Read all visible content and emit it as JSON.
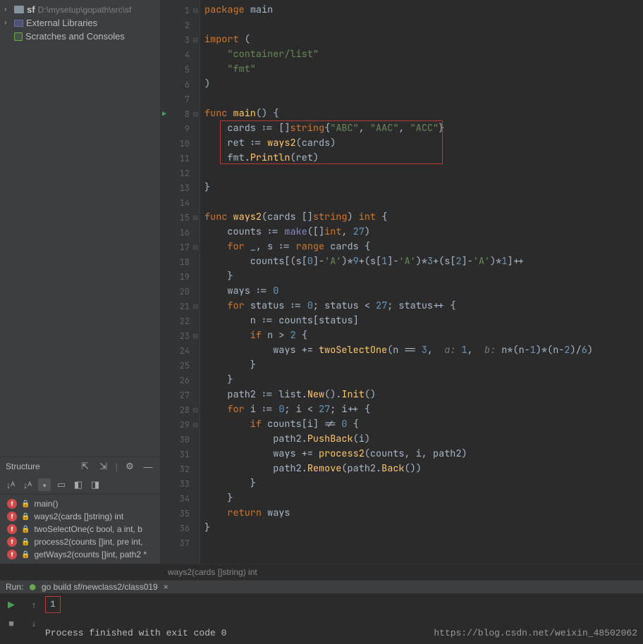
{
  "project": {
    "root_name": "sf",
    "root_path": "D:\\mysetup\\gopath\\src\\sf",
    "external_libs": "External Libraries",
    "scratches": "Scratches and Consoles"
  },
  "structure": {
    "title": "Structure",
    "items": [
      "main()",
      "ways2(cards []string) int",
      "twoSelectOne(c bool, a int, b",
      "process2(counts []int, pre int,",
      "getWays2(counts []int, path2 *"
    ]
  },
  "gutter": {
    "start": 1,
    "end": 37,
    "run_line": 8,
    "fold_minus": [
      1,
      3,
      8,
      15,
      17,
      21,
      23,
      28,
      29
    ],
    "fold_plus": []
  },
  "code": {
    "lines": [
      {
        "tokens": [
          {
            "t": "package ",
            "c": "kw"
          },
          {
            "t": "main",
            "c": "ident"
          }
        ]
      },
      {
        "tokens": []
      },
      {
        "tokens": [
          {
            "t": "import ",
            "c": "kw"
          },
          {
            "t": "(",
            "c": "ident"
          }
        ]
      },
      {
        "tokens": [
          {
            "t": "    \"container/list\"",
            "c": "str"
          }
        ]
      },
      {
        "tokens": [
          {
            "t": "    \"fmt\"",
            "c": "str"
          }
        ]
      },
      {
        "tokens": [
          {
            "t": ")",
            "c": "ident"
          }
        ]
      },
      {
        "tokens": []
      },
      {
        "tokens": [
          {
            "t": "func ",
            "c": "kw"
          },
          {
            "t": "main",
            "c": "fn"
          },
          {
            "t": "() {",
            "c": "ident"
          }
        ]
      },
      {
        "tokens": [
          {
            "t": "    cards := []",
            "c": "ident"
          },
          {
            "t": "string",
            "c": "kw"
          },
          {
            "t": "{",
            "c": "ident"
          },
          {
            "t": "\"ABC\"",
            "c": "str"
          },
          {
            "t": ", ",
            "c": "ident"
          },
          {
            "t": "\"AAC\"",
            "c": "str"
          },
          {
            "t": ", ",
            "c": "ident"
          },
          {
            "t": "\"ACC\"",
            "c": "str"
          },
          {
            "t": "}",
            "c": "ident"
          }
        ]
      },
      {
        "tokens": [
          {
            "t": "    ret := ",
            "c": "ident"
          },
          {
            "t": "ways2",
            "c": "fn"
          },
          {
            "t": "(cards)",
            "c": "ident"
          }
        ]
      },
      {
        "tokens": [
          {
            "t": "    fmt.",
            "c": "ident"
          },
          {
            "t": "Println",
            "c": "fn"
          },
          {
            "t": "(ret)",
            "c": "ident"
          }
        ]
      },
      {
        "tokens": []
      },
      {
        "tokens": [
          {
            "t": "}",
            "c": "ident"
          }
        ]
      },
      {
        "tokens": []
      },
      {
        "tokens": [
          {
            "t": "func ",
            "c": "kw"
          },
          {
            "t": "ways2",
            "c": "fn"
          },
          {
            "t": "(cards []",
            "c": "ident"
          },
          {
            "t": "string",
            "c": "kw"
          },
          {
            "t": ") ",
            "c": "ident"
          },
          {
            "t": "int",
            "c": "kw"
          },
          {
            "t": " {",
            "c": "ident"
          }
        ]
      },
      {
        "tokens": [
          {
            "t": "    counts := ",
            "c": "ident"
          },
          {
            "t": "make",
            "c": "builtin"
          },
          {
            "t": "([]",
            "c": "ident"
          },
          {
            "t": "int",
            "c": "kw"
          },
          {
            "t": ", ",
            "c": "ident"
          },
          {
            "t": "27",
            "c": "num"
          },
          {
            "t": ")",
            "c": "ident"
          }
        ]
      },
      {
        "tokens": [
          {
            "t": "    for ",
            "c": "kw"
          },
          {
            "t": "_, s := ",
            "c": "ident"
          },
          {
            "t": "range ",
            "c": "kw"
          },
          {
            "t": "cards {",
            "c": "ident"
          }
        ]
      },
      {
        "tokens": [
          {
            "t": "        counts[(s[",
            "c": "ident"
          },
          {
            "t": "0",
            "c": "num"
          },
          {
            "t": "]-",
            "c": "ident"
          },
          {
            "t": "'A'",
            "c": "str"
          },
          {
            "t": ")*",
            "c": "ident"
          },
          {
            "t": "9",
            "c": "num"
          },
          {
            "t": "+(s[",
            "c": "ident"
          },
          {
            "t": "1",
            "c": "num"
          },
          {
            "t": "]-",
            "c": "ident"
          },
          {
            "t": "'A'",
            "c": "str"
          },
          {
            "t": ")*",
            "c": "ident"
          },
          {
            "t": "3",
            "c": "num"
          },
          {
            "t": "+(s[",
            "c": "ident"
          },
          {
            "t": "2",
            "c": "num"
          },
          {
            "t": "]-",
            "c": "ident"
          },
          {
            "t": "'A'",
            "c": "str"
          },
          {
            "t": ")*",
            "c": "ident"
          },
          {
            "t": "1",
            "c": "num"
          },
          {
            "t": "]++",
            "c": "ident"
          }
        ]
      },
      {
        "tokens": [
          {
            "t": "    }",
            "c": "ident"
          }
        ]
      },
      {
        "tokens": [
          {
            "t": "    ways := ",
            "c": "ident"
          },
          {
            "t": "0",
            "c": "num"
          }
        ]
      },
      {
        "tokens": [
          {
            "t": "    for ",
            "c": "kw"
          },
          {
            "t": "status := ",
            "c": "ident"
          },
          {
            "t": "0",
            "c": "num"
          },
          {
            "t": "; status < ",
            "c": "ident"
          },
          {
            "t": "27",
            "c": "num"
          },
          {
            "t": "; status++ {",
            "c": "ident"
          }
        ]
      },
      {
        "tokens": [
          {
            "t": "        n := counts[status]",
            "c": "ident"
          }
        ]
      },
      {
        "tokens": [
          {
            "t": "        if ",
            "c": "kw"
          },
          {
            "t": "n > ",
            "c": "ident"
          },
          {
            "t": "2",
            "c": "num"
          },
          {
            "t": " {",
            "c": "ident"
          }
        ]
      },
      {
        "tokens": [
          {
            "t": "            ways += ",
            "c": "ident"
          },
          {
            "t": "twoSelectOne",
            "c": "fn"
          },
          {
            "t": "(n == ",
            "c": "ident"
          },
          {
            "t": "3",
            "c": "num"
          },
          {
            "t": ",  ",
            "c": "ident"
          },
          {
            "t": "a: ",
            "c": "comment-hint"
          },
          {
            "t": "1",
            "c": "num"
          },
          {
            "t": ",  ",
            "c": "ident"
          },
          {
            "t": "b: ",
            "c": "comment-hint"
          },
          {
            "t": "n*(n-",
            "c": "ident"
          },
          {
            "t": "1",
            "c": "num"
          },
          {
            "t": ")*(n-",
            "c": "ident"
          },
          {
            "t": "2",
            "c": "num"
          },
          {
            "t": ")/",
            "c": "ident"
          },
          {
            "t": "6",
            "c": "num"
          },
          {
            "t": ")",
            "c": "ident"
          }
        ]
      },
      {
        "tokens": [
          {
            "t": "        }",
            "c": "ident"
          }
        ]
      },
      {
        "tokens": [
          {
            "t": "    }",
            "c": "ident"
          }
        ]
      },
      {
        "tokens": [
          {
            "t": "    path2 := list.",
            "c": "ident"
          },
          {
            "t": "New",
            "c": "fn"
          },
          {
            "t": "().",
            "c": "ident"
          },
          {
            "t": "Init",
            "c": "fn"
          },
          {
            "t": "()",
            "c": "ident"
          }
        ]
      },
      {
        "tokens": [
          {
            "t": "    for ",
            "c": "kw"
          },
          {
            "t": "i := ",
            "c": "ident"
          },
          {
            "t": "0",
            "c": "num"
          },
          {
            "t": "; i < ",
            "c": "ident"
          },
          {
            "t": "27",
            "c": "num"
          },
          {
            "t": "; i++ {",
            "c": "ident"
          }
        ]
      },
      {
        "tokens": [
          {
            "t": "        if ",
            "c": "kw"
          },
          {
            "t": "counts[i] != ",
            "c": "ident"
          },
          {
            "t": "0",
            "c": "num"
          },
          {
            "t": " {",
            "c": "ident"
          }
        ]
      },
      {
        "tokens": [
          {
            "t": "            path2.",
            "c": "ident"
          },
          {
            "t": "PushBack",
            "c": "fn"
          },
          {
            "t": "(i)",
            "c": "ident"
          }
        ]
      },
      {
        "tokens": [
          {
            "t": "            ways += ",
            "c": "ident"
          },
          {
            "t": "process2",
            "c": "fn"
          },
          {
            "t": "(counts, i, path2)",
            "c": "ident"
          }
        ]
      },
      {
        "tokens": [
          {
            "t": "            path2.",
            "c": "ident"
          },
          {
            "t": "Remove",
            "c": "fn"
          },
          {
            "t": "(path2.",
            "c": "ident"
          },
          {
            "t": "Back",
            "c": "fn"
          },
          {
            "t": "())",
            "c": "ident"
          }
        ]
      },
      {
        "tokens": [
          {
            "t": "        }",
            "c": "ident"
          }
        ]
      },
      {
        "tokens": [
          {
            "t": "    }",
            "c": "ident"
          }
        ]
      },
      {
        "tokens": [
          {
            "t": "    return ",
            "c": "kw"
          },
          {
            "t": "ways",
            "c": "ident"
          }
        ]
      },
      {
        "tokens": [
          {
            "t": "}",
            "c": "ident"
          }
        ]
      },
      {
        "tokens": []
      }
    ]
  },
  "breadcrumb": "ways2(cards []string) int",
  "run": {
    "label": "Run:",
    "config": "go build sf/newclass2/class019",
    "output_value": "1",
    "exit_msg": "Process finished with exit code 0"
  },
  "watermark": "https://blog.csdn.net/weixin_48502062"
}
